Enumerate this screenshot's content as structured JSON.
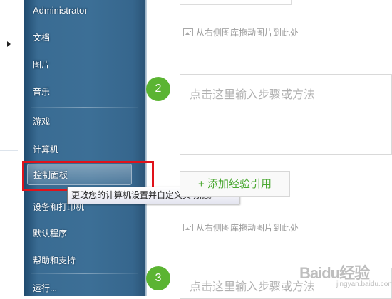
{
  "start_menu": {
    "items": [
      {
        "label": "Administrator"
      },
      {
        "label": "文档"
      },
      {
        "label": "图片"
      },
      {
        "label": "音乐"
      },
      {
        "label": "游戏"
      },
      {
        "label": "计算机"
      },
      {
        "label": "控制面板"
      },
      {
        "label": "设备和打印机"
      },
      {
        "label": "默认程序"
      },
      {
        "label": "帮助和支持"
      },
      {
        "label": "运行..."
      }
    ],
    "tooltip": "更改您的计算机设置并自定义其功能。"
  },
  "editor": {
    "image_hint_1": "从右侧图库拖动图片到此处",
    "image_hint_2": "从右侧图库拖动图片到此处",
    "steps": [
      {
        "number": "2",
        "placeholder": "点击这里输入步骤或方法"
      },
      {
        "number": "3",
        "placeholder": "点击这里输入步骤或方法"
      }
    ],
    "add_reference_label": "+ 添加经验引用"
  },
  "watermark": {
    "text": "Baidu经验",
    "sub": "jingyan.baidu.com"
  },
  "colors": {
    "accent_green": "#5bb432",
    "highlight_red": "#e0121a",
    "menu_blue": "#3a6c93"
  }
}
